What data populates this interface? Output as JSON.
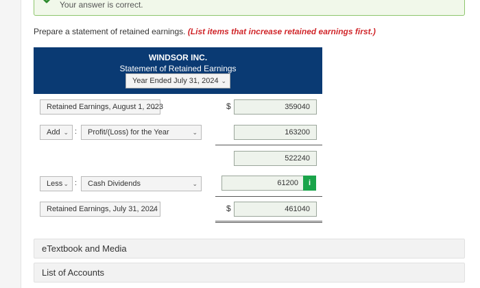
{
  "feedback": {
    "message": "Your answer is correct.",
    "status_color": "#8cc56a"
  },
  "prompt": {
    "text": "Prepare a statement of retained earnings.",
    "hint": "(List items that increase retained earnings first.)"
  },
  "statement": {
    "company": "WINDSOR INC.",
    "title": "Statement of Retained Earnings",
    "period": "Year Ended July 31, 2024",
    "header_color": "#0a3a73"
  },
  "rows": {
    "beginning": {
      "label": "Retained Earnings, August 1, 2023",
      "currency": "$",
      "amount": "359040"
    },
    "add": {
      "operator": "Add",
      "separator": ":",
      "label": "Profit/(Loss) for the Year",
      "amount": "163200"
    },
    "subtotal": {
      "amount": "522240"
    },
    "less": {
      "operator": "Less",
      "separator": ":",
      "label": "Cash Dividends",
      "amount": "61200",
      "info": "i"
    },
    "ending": {
      "label": "Retained Earnings, July 31, 2024",
      "currency": "$",
      "amount": "461040"
    }
  },
  "sections": {
    "etextbook": "eTextbook and Media",
    "accounts": "List of Accounts"
  }
}
